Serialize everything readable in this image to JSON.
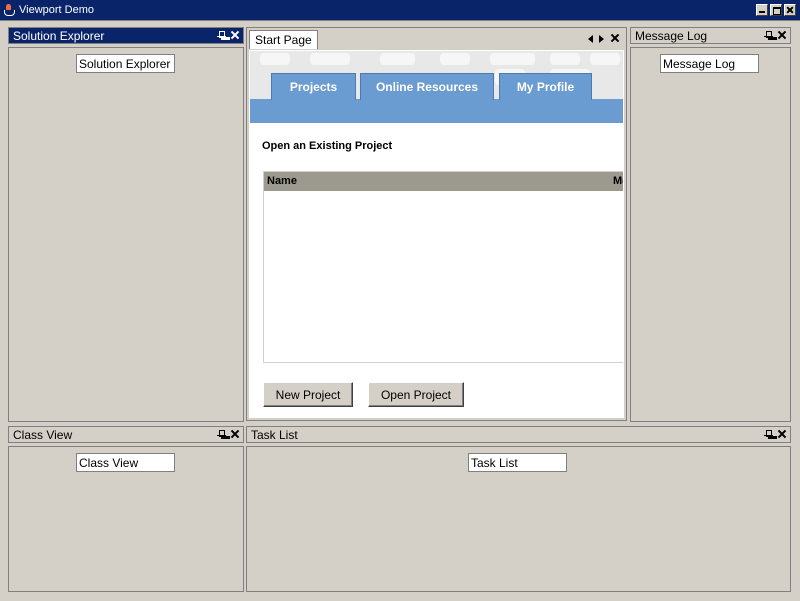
{
  "window": {
    "title": "Viewport Demo"
  },
  "colors": {
    "active_header": "#0a246a",
    "hero_blue": "#6a9bd1",
    "grid_header": "#9c9a8e"
  },
  "panels": {
    "solution_explorer": {
      "title": "Solution Explorer",
      "field": "Solution Explorer"
    },
    "message_log": {
      "title": "Message Log",
      "field": "Message Log"
    },
    "class_view": {
      "title": "Class View",
      "field": "Class View"
    },
    "task_list": {
      "title": "Task List",
      "field": "Task List"
    }
  },
  "start_page": {
    "tab_label": "Start Page",
    "tabs": [
      {
        "label": "Projects"
      },
      {
        "label": "Online Resources"
      },
      {
        "label": "My Profile"
      }
    ],
    "section_title": "Open an Existing Project",
    "grid_columns": [
      "Name",
      "Mo"
    ],
    "buttons": {
      "new_project": "New Project",
      "open_project": "Open Project"
    }
  }
}
